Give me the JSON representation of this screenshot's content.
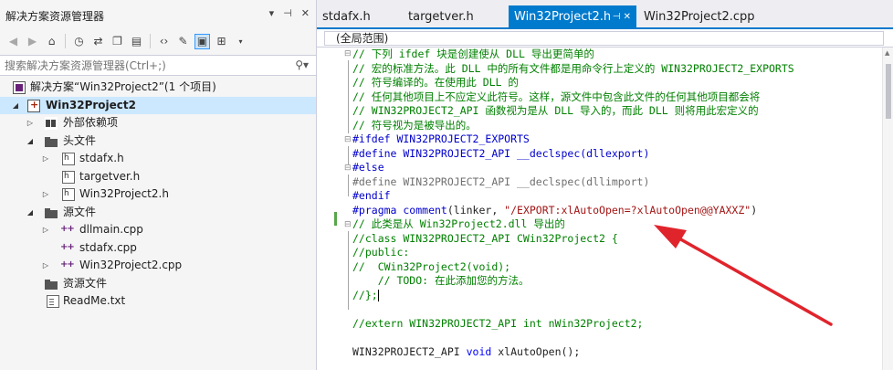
{
  "explorer": {
    "title": "解决方案资源管理器",
    "title_tools": [
      "▾",
      "⊣",
      "✕"
    ],
    "search_placeholder": "搜索解决方案资源管理器(Ctrl+;)",
    "tree": {
      "solution": "解决方案“Win32Project2”(1 个项目)",
      "project": "Win32Project2",
      "external_deps": "外部依赖项",
      "header_folder": "头文件",
      "header_files": [
        "stdafx.h",
        "targetver.h",
        "Win32Project2.h"
      ],
      "source_folder": "源文件",
      "source_files": [
        "dllmain.cpp",
        "stdafx.cpp",
        "Win32Project2.cpp"
      ],
      "resource_folder": "资源文件",
      "readme": "ReadMe.txt"
    }
  },
  "tabs": [
    {
      "label": "stdafx.h",
      "active": false
    },
    {
      "label": "targetver.h",
      "active": false
    },
    {
      "label": "Win32Project2.h",
      "active": true
    },
    {
      "label": "Win32Project2.cpp",
      "active": false
    }
  ],
  "editor": {
    "scope": "(全局范围)",
    "lines": [
      "// 下列 ifdef 块是创建使从 DLL 导出更简单的",
      "// 宏的标准方法。此 DLL 中的所有文件都是用命令行上定义的 WIN32PROJECT2_EXPORTS",
      "// 符号编译的。在使用此 DLL 的",
      "// 任何其他项目上不应定义此符号。这样，源文件中包含此文件的任何其他项目都会将",
      "// WIN32PROJECT2_API 函数视为是从 DLL 导入的，而此 DLL 则将用此宏定义的",
      "// 符号视为是被导出的。",
      "#ifdef WIN32PROJECT2_EXPORTS",
      "#define WIN32PROJECT2_API __declspec(dllexport)",
      "#else",
      "#define WIN32PROJECT2_API __declspec(dllimport)",
      "#endif",
      "#pragma comment(linker, \"/EXPORT:xlAutoOpen=?xlAutoOpen@@YAXXZ\")",
      "// 此类是从 Win32Project2.dll 导出的",
      "//class WIN32PROJECT2_API CWin32Project2 {",
      "//public:",
      "//  CWin32Project2(void);",
      "    // TODO: 在此添加您的方法。",
      "//};",
      "",
      "//extern WIN32PROJECT2_API int nWin32Project2;",
      "",
      "WIN32PROJECT2_API void xlAutoOpen();"
    ]
  },
  "colors": {
    "accent": "#007acc",
    "comment": "#008000",
    "preprocessor": "#0000cc",
    "string": "#a31515",
    "annotation_arrow": "#e0242c"
  }
}
